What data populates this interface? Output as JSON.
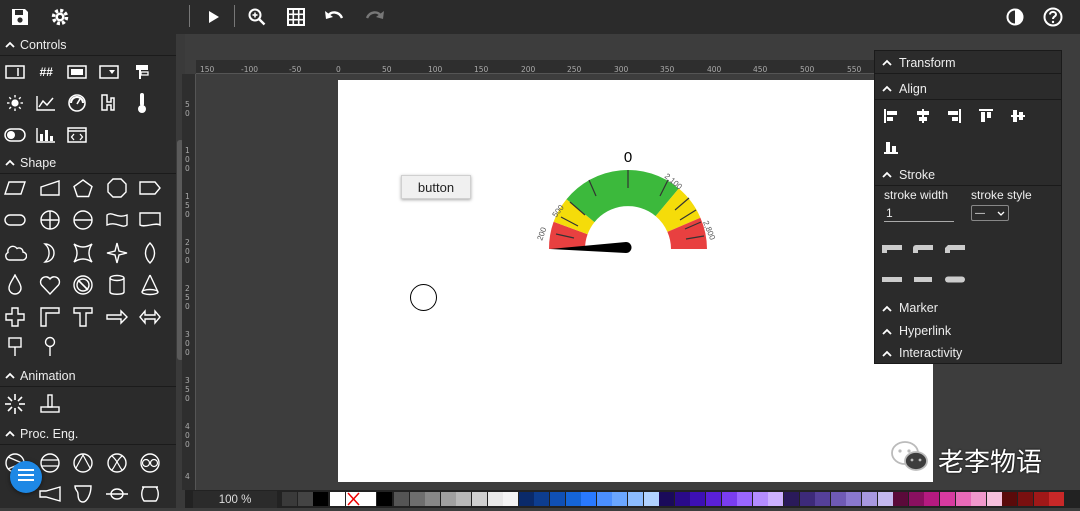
{
  "toolbar": {
    "save_icon": "save-icon",
    "settings_icon": "gear-icon",
    "play_icon": "play-icon",
    "zoom_icon": "zoom-icon",
    "grid_icon": "grid-icon",
    "undo_icon": "undo-icon",
    "redo_icon": "redo-icon",
    "contrast_icon": "contrast-icon",
    "help_icon": "help-icon"
  },
  "left_panel": {
    "sections": [
      {
        "label": "Controls"
      },
      {
        "label": "Shape"
      },
      {
        "label": "Animation"
      },
      {
        "label": "Proc. Eng."
      }
    ],
    "controls_text_icon": "##"
  },
  "ruler": {
    "h_ticks": [
      "150",
      "-100",
      "-50",
      "0",
      "50",
      "100",
      "150",
      "200",
      "250",
      "300",
      "350",
      "400",
      "450",
      "500",
      "550"
    ],
    "v_ticks": [
      "5 0",
      "1 0 0",
      "1 5 0",
      "2 0 0",
      "2 5 0",
      "3 0 0",
      "3 5 0",
      "4 0 0",
      "4"
    ]
  },
  "canvas": {
    "button_label": "button",
    "gauge": {
      "value": "0",
      "tick_labels": [
        "200",
        "500",
        "2,100",
        "2,800"
      ]
    }
  },
  "right_panel": {
    "sections": {
      "transform": "Transform",
      "align": "Align",
      "stroke": "Stroke",
      "marker": "Marker",
      "hyperlink": "Hyperlink",
      "interactivity": "Interactivity"
    },
    "stroke_width_label": "stroke width",
    "stroke_width_value": "1",
    "stroke_style_label": "stroke style",
    "stroke_style_value": "—"
  },
  "bottom": {
    "zoom": "100 %"
  },
  "watermark": {
    "text": "老李物语"
  },
  "colors": {
    "gauge_green": "#3cb93c",
    "gauge_yellow": "#f5dc0a",
    "gauge_red": "#e84040",
    "fab": "#1e88e5"
  }
}
